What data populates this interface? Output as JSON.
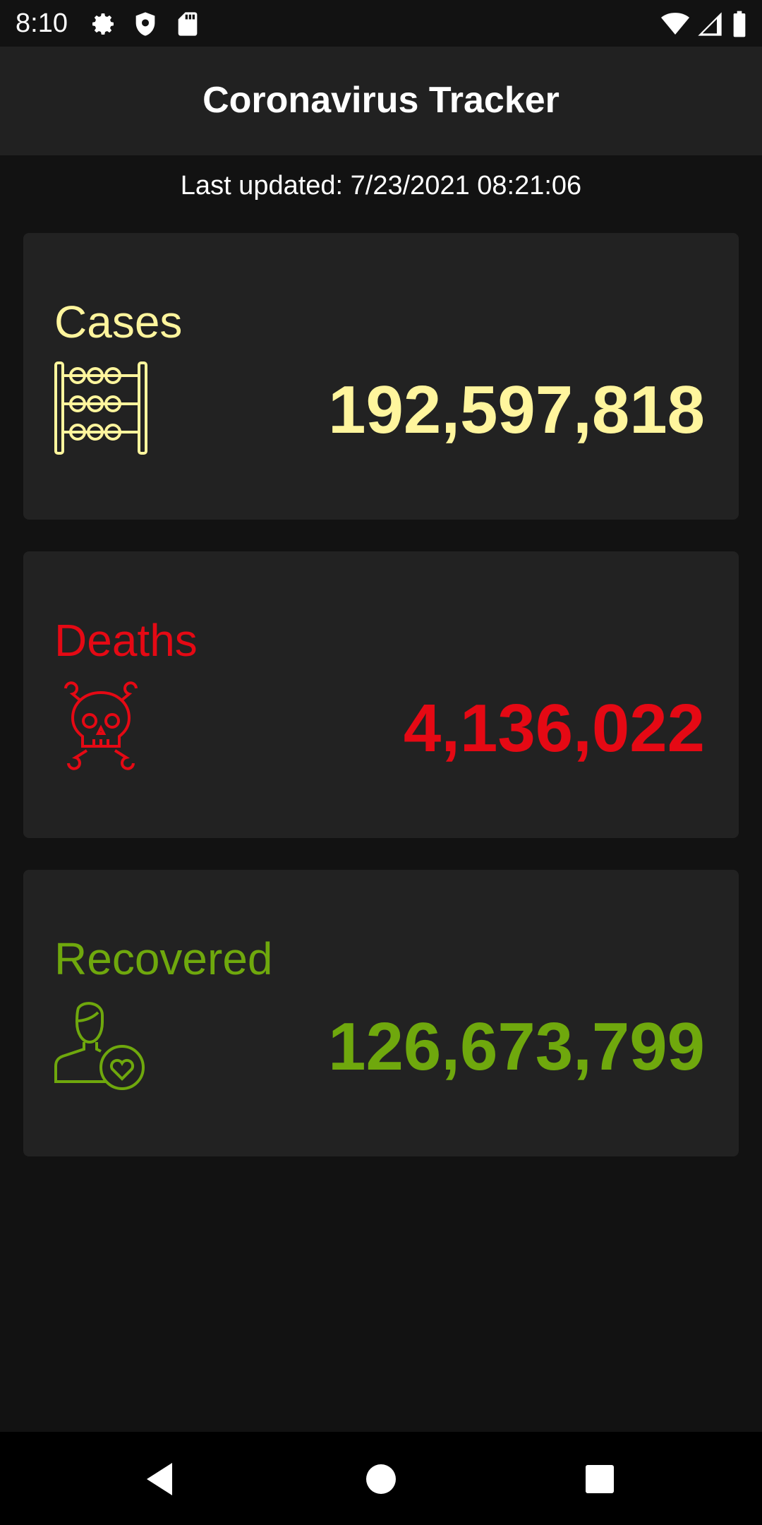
{
  "status_bar": {
    "time": "8:10",
    "left_icons": [
      "gear-icon",
      "shield-icon",
      "sd-card-icon"
    ],
    "right_icons": [
      "wifi-icon",
      "cell-signal-icon",
      "battery-icon"
    ]
  },
  "app_bar": {
    "title": "Coronavirus Tracker"
  },
  "last_updated": "Last updated: 7/23/2021 08:21:06",
  "cards": [
    {
      "label": "Cases",
      "value": "192,597,818",
      "color": "#fff59d",
      "icon": "abacus-icon"
    },
    {
      "label": "Deaths",
      "value": "4,136,022",
      "color": "#e50914",
      "icon": "skull-crossbones-icon"
    },
    {
      "label": "Recovered",
      "value": "126,673,799",
      "color": "#6fa80d",
      "icon": "person-heart-icon"
    }
  ],
  "nav_bar": {
    "buttons": [
      "back-icon",
      "home-icon",
      "recents-icon"
    ]
  },
  "colors": {
    "background": "#121212",
    "app_bar": "#212121",
    "card": "#222222"
  }
}
